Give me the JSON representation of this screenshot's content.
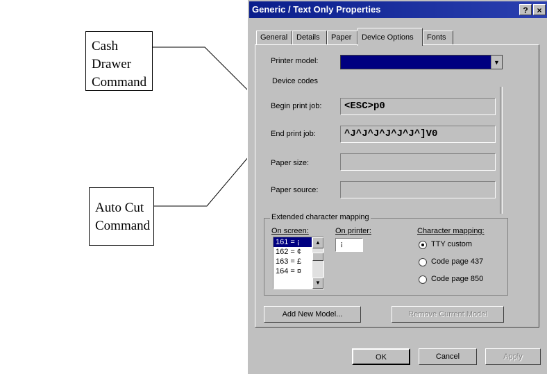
{
  "callouts": {
    "cash_drawer": {
      "line1": "Cash Drawer",
      "line2": "Command"
    },
    "auto_cut": {
      "line1": "Auto Cut",
      "line2": "Command"
    }
  },
  "dialog": {
    "title": "Generic / Text Only Properties",
    "help_label": "?",
    "close_label": "×",
    "tabs": [
      "General",
      "Details",
      "Paper",
      "Device Options",
      "Fonts"
    ],
    "active_tab": "Device Options"
  },
  "printer_model": {
    "label": "Printer model:",
    "value": ""
  },
  "device_codes": {
    "heading": "Device codes",
    "begin_print_job": {
      "label": "Begin print job:",
      "value": "<ESC>p0"
    },
    "end_print_job": {
      "label": "End print job:",
      "value": "^J^J^J^J^J^J^]V0"
    },
    "paper_size": {
      "label": "Paper size:",
      "value": ""
    },
    "paper_source": {
      "label": "Paper source:",
      "value": ""
    }
  },
  "extended_mapping": {
    "title": "Extended character mapping",
    "on_screen_label": "On screen:",
    "on_printer_label": "On printer:",
    "on_printer_value": "¡",
    "screen_list": [
      "161 = ¡",
      "162 = ¢",
      "163 = £",
      "164 = ¤"
    ],
    "char_mapping_label": "Character mapping:",
    "radios": [
      {
        "label": "TTY custom",
        "selected": true
      },
      {
        "label": "Code page 437",
        "selected": false
      },
      {
        "label": "Code page 850",
        "selected": false
      }
    ]
  },
  "model_buttons": {
    "add": "Add New Model...",
    "remove": "Remove Current Model"
  },
  "footer_buttons": {
    "ok": "OK",
    "cancel": "Cancel",
    "apply": "Apply"
  }
}
